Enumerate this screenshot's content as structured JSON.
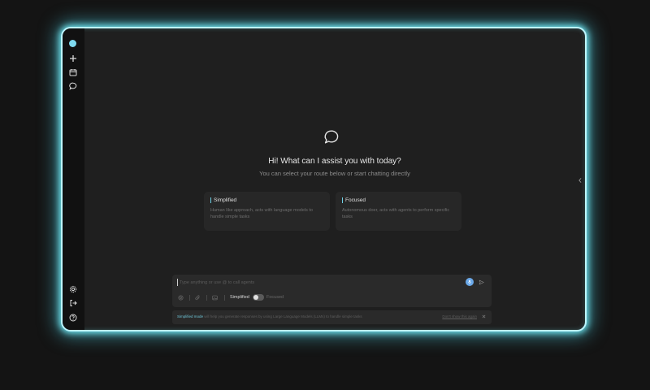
{
  "sidebar": {
    "top_icons": [
      "logo-dot",
      "plus-icon",
      "calendar-icon",
      "chat-icon"
    ],
    "bottom_icons": [
      "settings-icon",
      "logout-icon",
      "help-icon"
    ]
  },
  "main": {
    "greeting": "Hi! What can I assist you with today?",
    "subtitle": "You can select your route below or start chatting directly",
    "cards": [
      {
        "title": "Simplified",
        "description": "Human like approach, acts with language models to handle simple tasks"
      },
      {
        "title": "Focused",
        "description": "Autonomous doer, acts with agents to perform specific tasks"
      }
    ]
  },
  "composer": {
    "placeholder": "Type anything or use @ to call agents",
    "mode_simplified": "Simplified",
    "mode_focused": "Focused"
  },
  "notice": {
    "highlight": "Simplified mode",
    "text": " will help you generate responses by using Large Language Models (LLMs) to handle simple tasks",
    "link": "Don't show this again"
  },
  "colors": {
    "accent": "#6fd3e8",
    "glow": "#6fe3ee",
    "mic": "#6aa8e8"
  }
}
